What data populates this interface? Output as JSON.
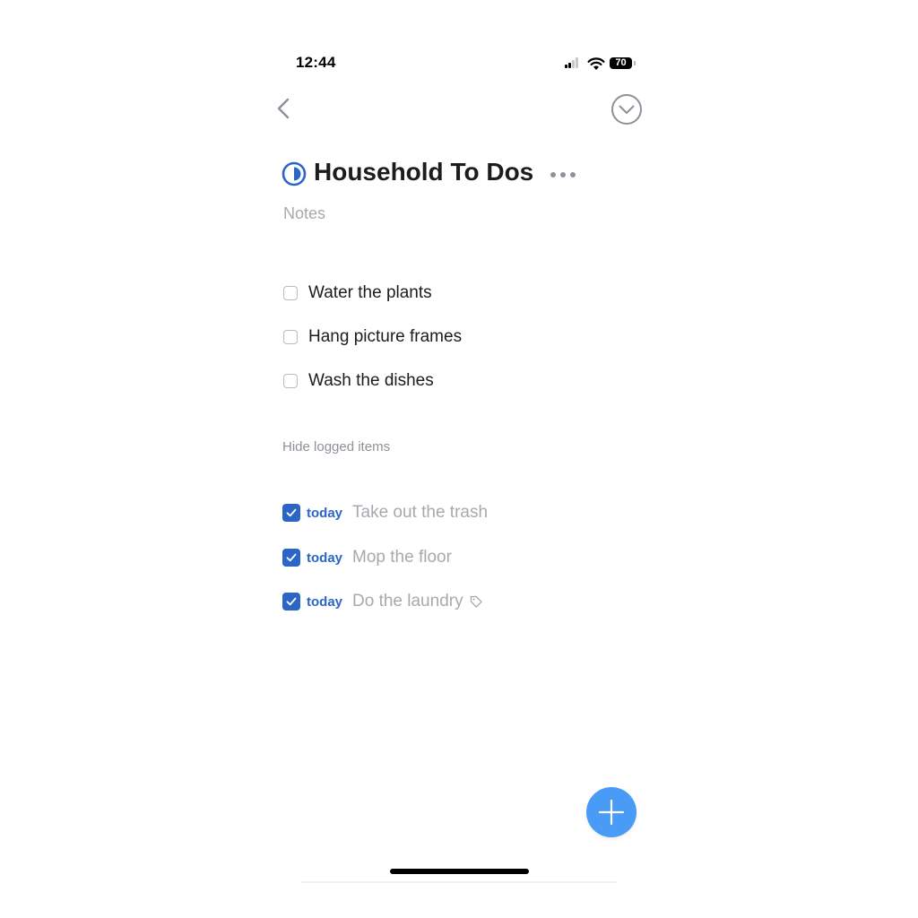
{
  "status_bar": {
    "time": "12:44",
    "battery": "70",
    "signal_icon": "cellular-signal-icon",
    "wifi_icon": "wifi-icon"
  },
  "nav": {
    "back_icon": "chevron-left-icon",
    "complete_icon": "circle-chevron-down-icon"
  },
  "project": {
    "icon": "half-filled-circle-icon",
    "title": "Household To Dos",
    "more_icon": "ellipsis-icon",
    "notes_placeholder": "Notes"
  },
  "todos": [
    {
      "title": "Water the plants",
      "checked": false
    },
    {
      "title": "Hang picture frames",
      "checked": false
    },
    {
      "title": "Wash the dishes",
      "checked": false
    }
  ],
  "hide_logged_label": "Hide logged items",
  "logged": [
    {
      "when": "today",
      "title": "Take out the trash",
      "checked": true,
      "tag": false
    },
    {
      "when": "today",
      "title": "Mop the floor",
      "checked": true,
      "tag": false
    },
    {
      "when": "today",
      "title": "Do the laundry",
      "checked": true,
      "tag": true
    }
  ],
  "add_button_icon": "plus-icon",
  "colors": {
    "accent": "#2b66c7",
    "fab": "#4a9bf5",
    "muted_text": "#a7a9ae"
  }
}
